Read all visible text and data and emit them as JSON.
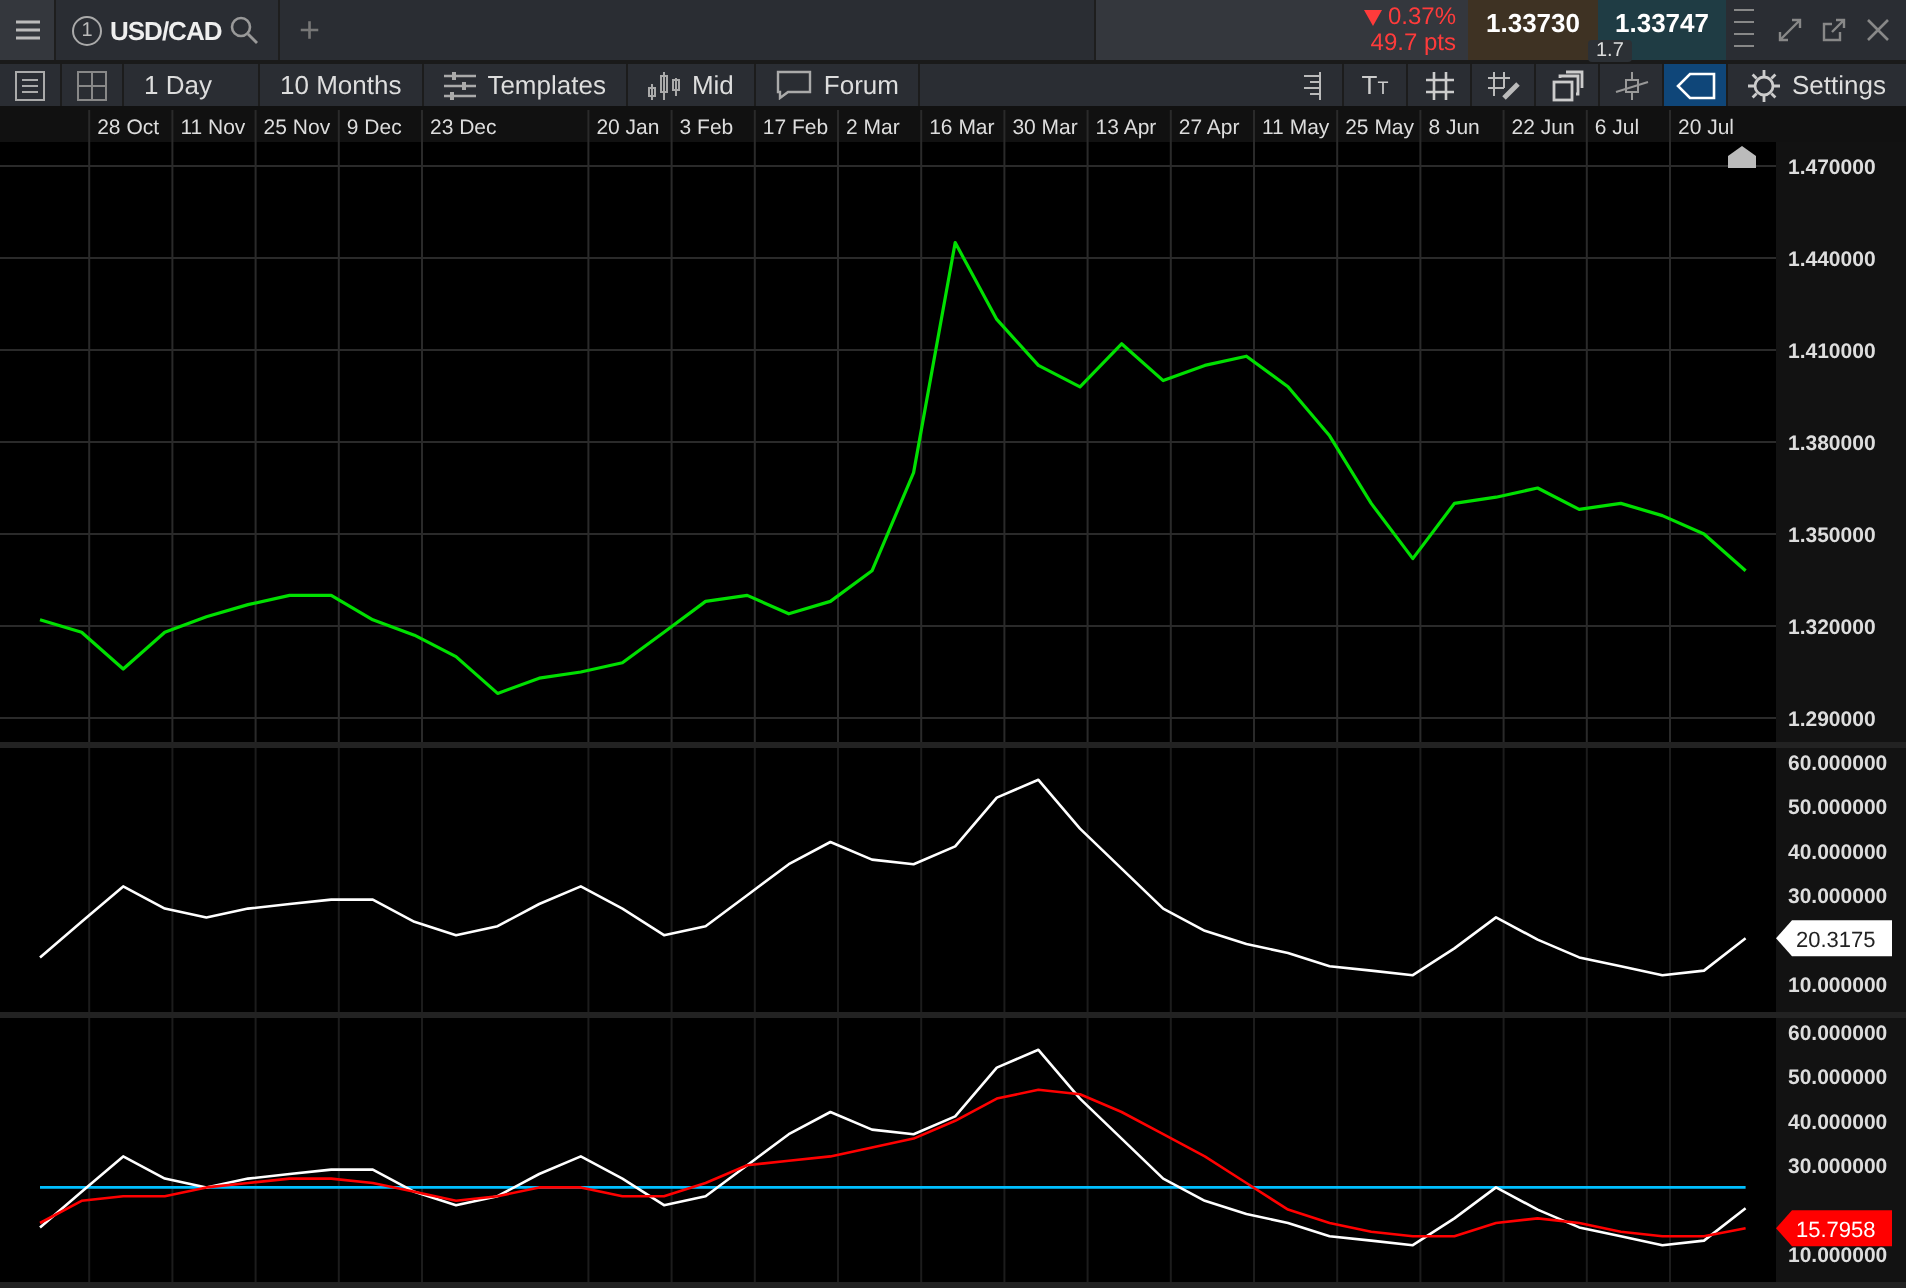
{
  "header": {
    "tab": {
      "number": "1",
      "symbol": "USD/CAD"
    },
    "add_tab": "+",
    "change": {
      "percent": "0.37%",
      "points": "49.7 pts",
      "falling": true
    },
    "sell_price": "1.33730",
    "buy_price": "1.33747",
    "spread": "1.7"
  },
  "toolbar": {
    "left": [
      {
        "kind": "icon"
      },
      {
        "kind": "icon"
      },
      {
        "kind": "text",
        "label": "1 Day"
      },
      {
        "kind": "text",
        "label": "10 Months"
      },
      {
        "kind": "icon_text",
        "label": "Templates"
      },
      {
        "kind": "icon_text",
        "label": "Mid"
      },
      {
        "kind": "icon_text",
        "label": "Forum"
      }
    ],
    "right": [
      {
        "kind": "icon",
        "selected": false
      },
      {
        "kind": "glyph",
        "big": "T",
        "small": "T",
        "selected": false
      },
      {
        "kind": "icon",
        "selected": false
      },
      {
        "kind": "icon",
        "selected": false
      },
      {
        "kind": "icon",
        "selected": false
      },
      {
        "kind": "icon",
        "selected": false
      },
      {
        "kind": "icon",
        "selected": true
      },
      {
        "kind": "icon_text",
        "label": "Settings",
        "selected": false
      }
    ]
  },
  "price_panel": {
    "chart_data": {
      "type": "line",
      "grid": true,
      "categories": [
        null,
        null,
        "28 Oct",
        null,
        "11 Nov",
        null,
        "25 Nov",
        null,
        "9 Dec",
        null,
        "23 Dec",
        null,
        null,
        null,
        "20 Jan",
        null,
        "3 Feb",
        null,
        "17 Feb",
        null,
        "2 Mar",
        null,
        "16 Mar",
        null,
        "30 Mar",
        null,
        "13 Apr",
        null,
        "27 Apr",
        null,
        "11 May",
        null,
        "25 May",
        null,
        "8 Jun",
        null,
        "22 Jun",
        null,
        "6 Jul",
        null,
        "20 Jul",
        null
      ],
      "series": [
        {
          "color": "#00e000",
          "values": [
            1.322,
            1.318,
            1.306,
            1.318,
            1.323,
            1.327,
            1.33,
            1.33,
            1.322,
            1.317,
            1.31,
            1.298,
            1.303,
            1.305,
            1.308,
            1.318,
            1.328,
            1.33,
            1.324,
            1.328,
            1.338,
            1.37,
            1.445,
            1.42,
            1.405,
            1.398,
            1.412,
            1.4,
            1.405,
            1.408,
            1.398,
            1.382,
            1.36,
            1.342,
            1.36,
            1.362,
            1.365,
            1.358,
            1.36,
            1.356,
            1.35,
            1.338
          ]
        }
      ],
      "ylim": [
        1.29,
        1.47
      ],
      "yticks": [
        {
          "value": 1.29,
          "label": "1.290000"
        },
        {
          "value": 1.32,
          "label": "1.320000"
        },
        {
          "value": 1.35,
          "label": "1.350000"
        },
        {
          "value": 1.38,
          "label": "1.380000"
        },
        {
          "value": 1.41,
          "label": "1.410000"
        },
        {
          "value": 1.44,
          "label": "1.440000"
        },
        {
          "value": 1.47,
          "label": "1.470000"
        }
      ]
    }
  },
  "indicator_panels": [
    {
      "last_value_label": "20.3175",
      "chart_data": {
        "type": "line",
        "grid": true,
        "series": [
          {
            "color": "#ffffff",
            "values": [
              16,
              24,
              32,
              27,
              25,
              27,
              28,
              29,
              29,
              24,
              21,
              23,
              28,
              32,
              27,
              21,
              23,
              30,
              37,
              42,
              38,
              37,
              41,
              52,
              56,
              45,
              36,
              27,
              22,
              19,
              17,
              14,
              13,
              12,
              18,
              25,
              20,
              16,
              14,
              12,
              13,
              20.3
            ]
          }
        ],
        "ylim": [
          10,
          60
        ],
        "yticks": [
          {
            "value": 10,
            "label": "10.000000"
          },
          {
            "value": 30,
            "label": "30.000000"
          },
          {
            "value": 40,
            "label": "40.000000"
          },
          {
            "value": 50,
            "label": "50.000000"
          },
          {
            "value": 60,
            "label": "60.000000"
          }
        ]
      }
    },
    {
      "last_value_label": "15.7958",
      "chart_data": {
        "type": "line",
        "grid": true,
        "series": [
          {
            "color": "#00bfff",
            "values": [
              25,
              25,
              25,
              25,
              25,
              25,
              25,
              25,
              25,
              25,
              25,
              25,
              25,
              25,
              25,
              25,
              25,
              25,
              25,
              25,
              25,
              25,
              25,
              25,
              25,
              25,
              25,
              25,
              25,
              25,
              25,
              25,
              25,
              25,
              25,
              25,
              25,
              25,
              25,
              25,
              25,
              25
            ]
          },
          {
            "color": "#ffffff",
            "values": [
              16,
              24,
              32,
              27,
              25,
              27,
              28,
              29,
              29,
              24,
              21,
              23,
              28,
              32,
              27,
              21,
              23,
              30,
              37,
              42,
              38,
              37,
              41,
              52,
              56,
              45,
              36,
              27,
              22,
              19,
              17,
              14,
              13,
              12,
              18,
              25,
              20,
              16,
              14,
              12,
              13,
              20.3
            ]
          },
          {
            "color": "#ff0000",
            "values": [
              17,
              22,
              23,
              23,
              25,
              26,
              27,
              27,
              26,
              24,
              22,
              23,
              25,
              25,
              23,
              23,
              26,
              30,
              31,
              32,
              34,
              36,
              40,
              45,
              47,
              46,
              42,
              37,
              32,
              26,
              20,
              17,
              15,
              14,
              14,
              17,
              18,
              17,
              15,
              14,
              14,
              15.8
            ]
          }
        ],
        "ylim": [
          10,
          60
        ],
        "yticks": [
          {
            "value": 10,
            "label": "10.000000"
          },
          {
            "value": 30,
            "label": "30.000000"
          },
          {
            "value": 40,
            "label": "40.000000"
          },
          {
            "value": 50,
            "label": "50.000000"
          },
          {
            "value": 60,
            "label": "60.000000"
          }
        ]
      }
    }
  ]
}
